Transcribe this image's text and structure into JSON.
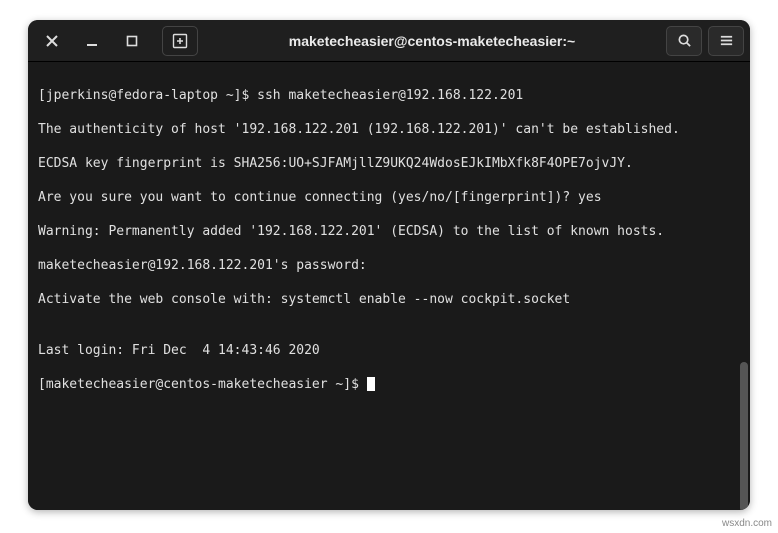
{
  "titlebar": {
    "title": "maketecheasier@centos-maketecheasier:~"
  },
  "terminal": {
    "lines": [
      "[jperkins@fedora-laptop ~]$ ssh maketecheasier@192.168.122.201",
      "The authenticity of host '192.168.122.201 (192.168.122.201)' can't be established.",
      "ECDSA key fingerprint is SHA256:UO+SJFAMjllZ9UKQ24WdosEJkIMbXfk8F4OPE7ojvJY.",
      "Are you sure you want to continue connecting (yes/no/[fingerprint])? yes",
      "Warning: Permanently added '192.168.122.201' (ECDSA) to the list of known hosts.",
      "maketecheasier@192.168.122.201's password:",
      "Activate the web console with: systemctl enable --now cockpit.socket",
      "",
      "Last login: Fri Dec  4 14:43:46 2020",
      "[maketecheasier@centos-maketecheasier ~]$ "
    ]
  },
  "watermark": "wsxdn.com"
}
